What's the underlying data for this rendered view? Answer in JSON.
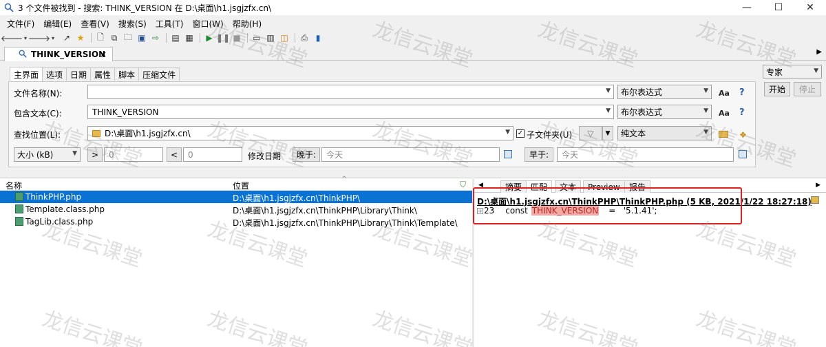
{
  "window": {
    "title": "3 个文件被找到 - 搜索: THINK_VERSION 在 D:\\桌面\\h1.jsgjzfx.cn\\",
    "minimize": "—",
    "maximize": "☐",
    "close": "✕"
  },
  "menu": [
    "文件(F)",
    "编辑(E)",
    "查看(V)",
    "搜索(S)",
    "工具(T)",
    "窗口(W)",
    "帮助(H)"
  ],
  "search_tab": {
    "label": "THINK_VERSION",
    "close": "×"
  },
  "subtabs": [
    "主界面",
    "选项",
    "日期",
    "属性",
    "脚本",
    "压缩文件"
  ],
  "form": {
    "filename_label": "文件名称(N):",
    "filename_value": "",
    "containing_label": "包含文本(C):",
    "containing_value": "THINK_VERSION",
    "location_label": "查找位置(L):",
    "location_value": "D:\\桌面\\h1.jsgjzfx.cn\\",
    "bool_mode_1": "布尔表达式",
    "bool_mode_2": "布尔表达式",
    "aa_label": "Aa",
    "help_label": "?",
    "subfolders_label": "子文件夹(U)",
    "subfolders_checked": "✓",
    "plain_text": "纯文本",
    "size_combo": "大小 (kB)",
    "gt_label": ">",
    "gt_value": "0",
    "lt_label": "<",
    "lt_value": "0",
    "modified_label": "修改日期",
    "after_label": "晚于:",
    "after_value": "今天",
    "before_label": "早于:",
    "before_value": "今天"
  },
  "right_panel": {
    "mode": "专家",
    "start": "开始",
    "stop": "停止"
  },
  "results": {
    "col_name": "名称",
    "col_location": "位置",
    "rows": [
      {
        "name": "ThinkPHP.php",
        "path": "D:\\桌面\\h1.jsgjzfx.cn\\ThinkPHP\\",
        "selected": true
      },
      {
        "name": "Template.class.php",
        "path": "D:\\桌面\\h1.jsgjzfx.cn\\ThinkPHP\\Library\\Think\\",
        "selected": false
      },
      {
        "name": "TagLib.class.php",
        "path": "D:\\桌面\\h1.jsgjzfx.cn\\ThinkPHP\\Library\\Think\\Template\\",
        "selected": false
      }
    ]
  },
  "preview": {
    "tabs": [
      "摘要",
      "匹配",
      "文本",
      "Preview",
      "报告"
    ],
    "file_header": "D:\\桌面\\h1.jsgjzfx.cn\\ThinkPHP\\ThinkPHP.php   (5 KB,  2021/1/22 18:27:18)",
    "line_no": "23",
    "code_before": "const",
    "code_match": "THINK_VERSION",
    "code_after": "=   '5.1.41';"
  },
  "watermark": "龙信云课堂",
  "colors": {
    "selection": "#0a72d3",
    "highlight_box": "#e02020",
    "match_bg": "#f3a8a3"
  }
}
